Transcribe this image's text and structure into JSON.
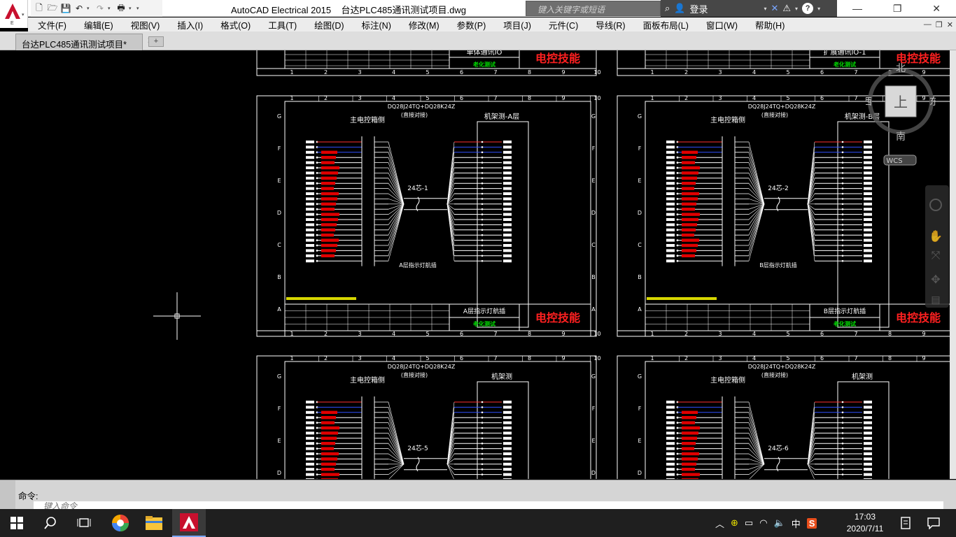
{
  "app": {
    "window_title": "AutoCAD Electrical 2015",
    "file_name": "台达PLC485通讯测试项目.dwg",
    "logo_letter": "E",
    "search_placeholder": "键入关键字或短语",
    "login_label": "登录"
  },
  "menu": [
    "文件(F)",
    "编辑(E)",
    "视图(V)",
    "插入(I)",
    "格式(O)",
    "工具(T)",
    "绘图(D)",
    "标注(N)",
    "修改(M)",
    "参数(P)",
    "项目(J)",
    "元件(C)",
    "导线(R)",
    "面板布局(L)",
    "窗口(W)",
    "帮助(H)"
  ],
  "tabs": [
    {
      "label": "台达PLC485通讯测试项目*"
    }
  ],
  "viewcube": {
    "north": "北",
    "south": "南",
    "east": "东",
    "west": "西",
    "face": "上",
    "wcs": "WCS"
  },
  "command": {
    "label": "命令:",
    "placeholder": "键入命令"
  },
  "taskbar": {
    "time": "17:03",
    "date": "2020/7/11",
    "ime": "中"
  },
  "drawing": {
    "col_numbers": [
      "1",
      "2",
      "3",
      "4",
      "5",
      "6",
      "7",
      "8",
      "9",
      "10"
    ],
    "row_letters": [
      "G",
      "F",
      "E",
      "D",
      "C",
      "B",
      "A"
    ],
    "top_row_titles": [
      "单体通讯IO",
      "扩展通讯IO-1"
    ],
    "aging_label": "老化测试",
    "brand_label": "电控技能",
    "sheets": [
      {
        "model": "DQ28J24TQ+DQ28K24Z",
        "note": "(直接对接)",
        "left": "主电控箱侧",
        "right": "机架测-A层",
        "cable": "24芯-1",
        "caption": "A层指示灯航插",
        "title": "A层指示灯航插"
      },
      {
        "model": "DQ28J24TQ+DQ28K24Z",
        "note": "(直接对接)",
        "left": "主电控箱侧",
        "right": "机架测-B层",
        "cable": "24芯-2",
        "caption": "B层指示灯航插",
        "title": "B层指示灯航插"
      },
      {
        "model": "DQ28J24TQ+DQ28K24Z",
        "note": "(直接对接)",
        "left": "主电控箱侧",
        "right": "机架测",
        "cable": "24芯-5",
        "caption": "",
        "title": ""
      },
      {
        "model": "DQ28J24TQ+DQ28K24Z",
        "note": "(直接对接)",
        "left": "主电控箱侧",
        "right": "机架测",
        "cable": "24芯-6",
        "caption": "",
        "title": ""
      }
    ]
  }
}
